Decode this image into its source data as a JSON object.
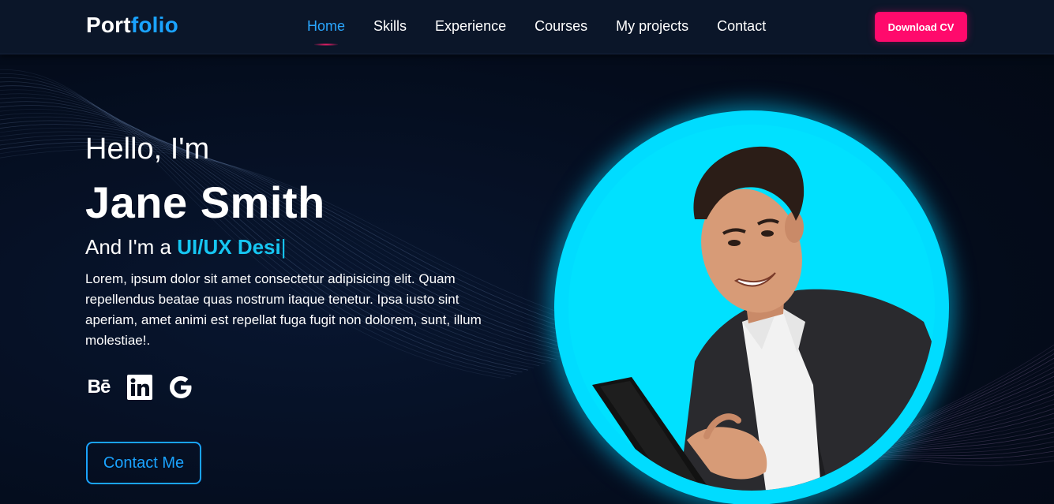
{
  "header": {
    "logo_part1": "Port",
    "logo_part2": "folio",
    "nav": [
      {
        "label": "Home",
        "active": true
      },
      {
        "label": "Skills",
        "active": false
      },
      {
        "label": "Experience",
        "active": false
      },
      {
        "label": "Courses",
        "active": false
      },
      {
        "label": "My projects",
        "active": false
      },
      {
        "label": "Contact",
        "active": false
      }
    ],
    "download_label": "Download CV"
  },
  "hero": {
    "greeting": "Hello, I'm",
    "name": "Jane Smith",
    "role_prefix": "And I'm a ",
    "role_typed": "UI/UX Desi",
    "role_cursor": "|",
    "description": "Lorem, ipsum dolor sit amet consectetur adipisicing elit. Quam repellendus beatae quas nostrum itaque tenetur. Ipsa iusto sint aperiam, amet animi est repellat fuga fugit non dolorem, sunt, illum molestiae!.",
    "socials": [
      {
        "icon": "behance-icon",
        "glyph": "Bē"
      },
      {
        "icon": "linkedin-icon",
        "glyph": "in"
      },
      {
        "icon": "google-icon",
        "glyph": "G"
      }
    ],
    "contact_label": "Contact Me"
  },
  "colors": {
    "background": "#040c1c",
    "header_bg": "#0b1629",
    "accent_blue": "#1aa3ff",
    "accent_cyan": "#16c6f2",
    "cta_pink": "#ff0a6c",
    "portrait_ring": "#00dcff"
  }
}
